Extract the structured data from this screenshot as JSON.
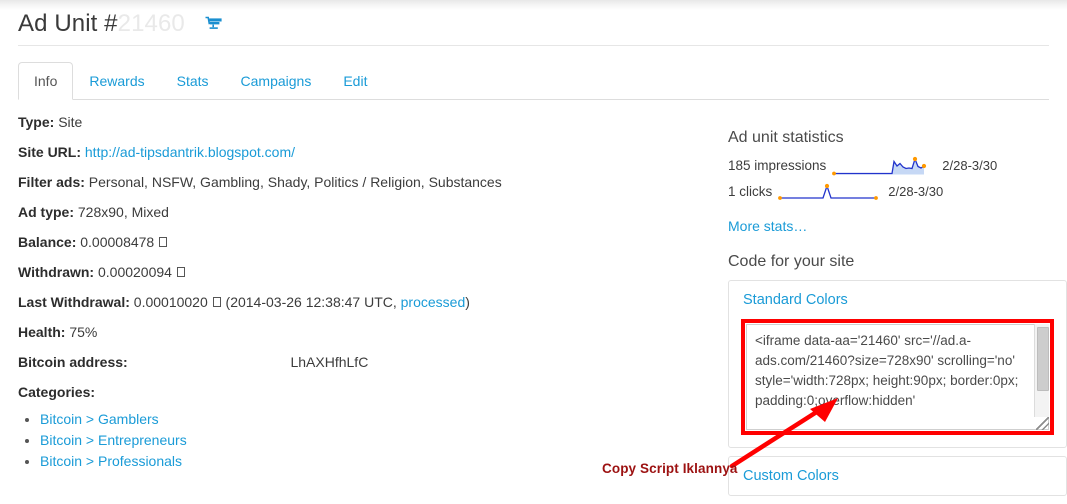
{
  "header": {
    "title_prefix": "Ad Unit #",
    "title_number_redacted": "21460",
    "cart_icon": "shopping-cart-icon"
  },
  "tabs": [
    {
      "label": "Info",
      "active": true
    },
    {
      "label": "Rewards",
      "active": false
    },
    {
      "label": "Stats",
      "active": false
    },
    {
      "label": "Campaigns",
      "active": false
    },
    {
      "label": "Edit",
      "active": false
    }
  ],
  "info": {
    "type_label": "Type:",
    "type_value": "Site",
    "site_url_label": "Site URL:",
    "site_url_value": "http://ad-tipsdantrik.blogspot.com/",
    "filter_ads_label": "Filter ads:",
    "filter_ads_value": "Personal, NSFW, Gambling, Shady, Politics / Religion, Substances",
    "ad_type_label": "Ad type:",
    "ad_type_value": "728x90, Mixed",
    "balance_label": "Balance:",
    "balance_value": "0.00008478",
    "withdrawn_label": "Withdrawn:",
    "withdrawn_value": "0.00020094",
    "last_withdrawal_label": "Last Withdrawal:",
    "last_withdrawal_value": "0.00010020",
    "last_withdrawal_date": "(2014-03-26 12:38:47 UTC,",
    "last_withdrawal_status": "processed",
    "last_withdrawal_close": ")",
    "health_label": "Health:",
    "health_value": "75%",
    "bitcoin_address_label": "Bitcoin address:",
    "bitcoin_address_value": "LhAXHfhLfC",
    "categories_label": "Categories:",
    "categories": [
      "Bitcoin > Gamblers",
      "Bitcoin > Entrepreneurs",
      "Bitcoin > Professionals"
    ]
  },
  "statistics": {
    "heading": "Ad unit statistics",
    "impressions_text": "185 impressions",
    "impressions_range": "2/28-3/30",
    "clicks_text": "1 clicks",
    "clicks_range": "2/28-3/30",
    "more_stats_label": "More stats…"
  },
  "code_section": {
    "heading": "Code for your site",
    "standard_colors_label": "Standard Colors",
    "custom_colors_label": "Custom Colors",
    "snippet": "<iframe data-aa='21460' src='//ad.a-ads.com/21460?size=728x90' scrolling='no' style='width:728px; height:90px; border:0px; padding:0;overflow:hidden'"
  },
  "annotation": {
    "caption": "Copy Script Iklannya",
    "arrow_color": "#ff0000",
    "caption_color": "#9c1111",
    "box_color": "#ff0000"
  },
  "colors": {
    "link": "#1a9bd7",
    "text": "#333333",
    "spark_line": "#2233cc",
    "spark_fill": "#c6d8f5",
    "spark_marker": "#ff9900"
  },
  "chart_data": [
    {
      "type": "area",
      "title": "185 impressions",
      "xlabel": "",
      "ylabel": "",
      "x": [
        0,
        1,
        2,
        3,
        4,
        5,
        6,
        7,
        8,
        9,
        10,
        11,
        12,
        13,
        14,
        15,
        16,
        17,
        18,
        19,
        20,
        21,
        22,
        23,
        24,
        25,
        26,
        27,
        28,
        29,
        30
      ],
      "values": [
        0,
        0,
        0,
        0,
        0,
        0,
        0,
        0,
        0,
        0,
        0,
        0,
        0,
        0,
        0,
        0,
        0,
        0,
        24,
        10,
        19,
        14,
        9,
        9,
        12,
        11,
        11,
        30,
        12,
        10,
        14
      ],
      "range_label": "2/28-3/30",
      "grid": false,
      "legend": "none",
      "markers": [
        {
          "x": 0,
          "kind": "start"
        },
        {
          "x": 27,
          "kind": "max"
        },
        {
          "x": 30,
          "kind": "end"
        }
      ]
    },
    {
      "type": "line",
      "title": "1 clicks",
      "xlabel": "",
      "ylabel": "",
      "x": [
        0,
        1,
        2,
        3,
        4,
        5,
        6,
        7,
        8,
        9,
        10,
        11,
        12,
        13,
        14,
        15,
        16,
        17,
        18,
        19,
        20,
        21,
        22,
        23,
        24,
        25,
        26,
        27,
        28,
        29,
        30
      ],
      "values": [
        0,
        0,
        0,
        0,
        0,
        0,
        0,
        0,
        0,
        0,
        0,
        0,
        0,
        1,
        0,
        0,
        0,
        0,
        0,
        0,
        0,
        0,
        0,
        0,
        0,
        0,
        0,
        0,
        0,
        0,
        0
      ],
      "range_label": "2/28-3/30",
      "grid": false,
      "legend": "none",
      "markers": [
        {
          "x": 0,
          "kind": "start"
        },
        {
          "x": 13,
          "kind": "max"
        },
        {
          "x": 30,
          "kind": "end"
        }
      ]
    }
  ]
}
